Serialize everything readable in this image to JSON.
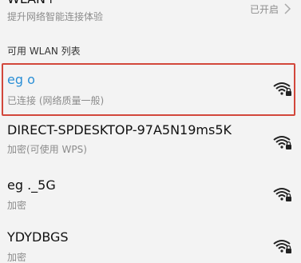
{
  "wlan_plus": {
    "title": "WLAN+",
    "description": "提升网络智能连接体验",
    "status": "已开启"
  },
  "section_title": "可用 WLAN 列表",
  "networks": [
    {
      "name": "eg o",
      "status": "已连接 (网络质量一般)",
      "connected": true,
      "icon": "wifi-lock-icon"
    },
    {
      "name": "DIRECT-SPDESKTOP-97A5N19ms5K",
      "status": "加密(可使用 WPS)",
      "connected": false,
      "icon": "wifi-lock-icon"
    },
    {
      "name": "eg ._5G",
      "status": "加密",
      "connected": false,
      "icon": "wifi-lock-icon"
    },
    {
      "name": "YDYDBGS",
      "status": "加密",
      "connected": false,
      "icon": "wifi-lock-icon"
    }
  ],
  "colors": {
    "accent": "#2a8fd6",
    "highlight_border": "#d2473b"
  }
}
